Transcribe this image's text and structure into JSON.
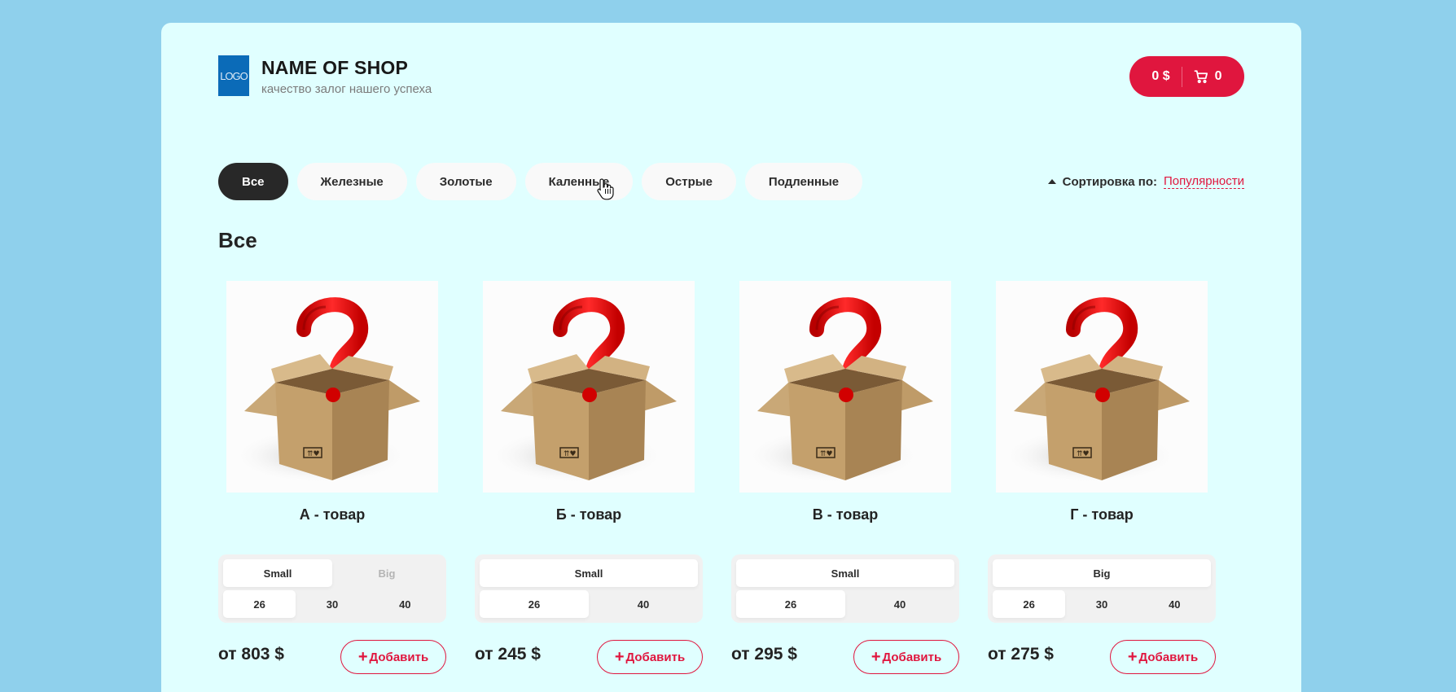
{
  "header": {
    "logo_text": "LOGO",
    "shop_name": "NAME OF SHOP",
    "slogan": "качество залог нашего успеха",
    "cart": {
      "sum": "0 $",
      "count": "0"
    }
  },
  "categories": [
    "Все",
    "Железные",
    "Золотые",
    "Каленные",
    "Острые",
    "Подленные"
  ],
  "active_category": "Все",
  "sort": {
    "label": "Сортировка по:",
    "value": "Популярности"
  },
  "section_title": "Все",
  "products": [
    {
      "title": "А - товар",
      "types": [
        {
          "label": "Small",
          "state": "active"
        },
        {
          "label": "Big",
          "state": "disabled"
        }
      ],
      "sizes": [
        {
          "label": "26",
          "state": "active"
        },
        {
          "label": "30",
          "state": "normal"
        },
        {
          "label": "40",
          "state": "normal"
        }
      ],
      "price": "от 803 $",
      "add_label": "Добавить"
    },
    {
      "title": "Б - товар",
      "types": [
        {
          "label": "Small",
          "state": "active"
        }
      ],
      "sizes": [
        {
          "label": "26",
          "state": "active"
        },
        {
          "label": "40",
          "state": "normal"
        }
      ],
      "price": "от 245 $",
      "add_label": "Добавить"
    },
    {
      "title": "В - товар",
      "types": [
        {
          "label": "Small",
          "state": "active"
        }
      ],
      "sizes": [
        {
          "label": "26",
          "state": "active"
        },
        {
          "label": "40",
          "state": "normal"
        }
      ],
      "price": "от 295 $",
      "add_label": "Добавить"
    },
    {
      "title": "Г - товар",
      "types": [
        {
          "label": "Big",
          "state": "active"
        }
      ],
      "sizes": [
        {
          "label": "26",
          "state": "active"
        },
        {
          "label": "30",
          "state": "normal"
        },
        {
          "label": "40",
          "state": "normal"
        }
      ],
      "price": "от 275 $",
      "add_label": "Добавить"
    }
  ],
  "colors": {
    "accent": "#e0163e",
    "page_bg": "#8fd0ec",
    "content_bg": "#e0ffff",
    "dark": "#282828"
  }
}
